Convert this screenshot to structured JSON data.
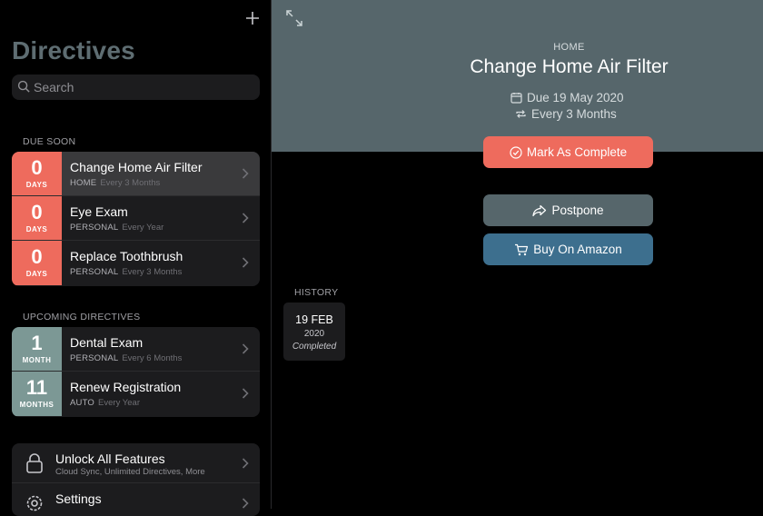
{
  "sidebar": {
    "title": "Directives",
    "search_placeholder": "Search",
    "due_soon_label": "DUE SOON",
    "due_soon": [
      {
        "count": "0",
        "unit": "DAYS",
        "name": "Change Home Air Filter",
        "category": "HOME",
        "frequency": "Every 3 Months"
      },
      {
        "count": "0",
        "unit": "DAYS",
        "name": "Eye Exam",
        "category": "PERSONAL",
        "frequency": "Every Year"
      },
      {
        "count": "0",
        "unit": "DAYS",
        "name": "Replace Toothbrush",
        "category": "PERSONAL",
        "frequency": "Every 3 Months"
      }
    ],
    "upcoming_label": "UPCOMING DIRECTIVES",
    "upcoming": [
      {
        "count": "1",
        "unit": "MONTH",
        "name": "Dental Exam",
        "category": "PERSONAL",
        "frequency": "Every 6 Months"
      },
      {
        "count": "11",
        "unit": "MONTHS",
        "name": "Renew Registration",
        "category": "AUTO",
        "frequency": "Every Year"
      }
    ],
    "unlock": {
      "title": "Unlock All Features",
      "subtitle": "Cloud Sync, Unlimited Directives, More"
    },
    "settings": {
      "title": "Settings"
    }
  },
  "detail": {
    "category": "HOME",
    "title": "Change Home Air Filter",
    "due": "Due 19 May 2020",
    "frequency": "Every 3 Months",
    "complete_label": "Mark As Complete",
    "postpone_label": "Postpone",
    "amazon_label": "Buy On Amazon",
    "history_label": "HISTORY",
    "history": [
      {
        "date": "19 FEB",
        "year": "2020",
        "status": "Completed"
      }
    ]
  },
  "icons": {
    "add": "plus-icon",
    "search": "search-icon",
    "chevron": "chevron-right-icon",
    "lock": "lock-icon",
    "settings": "gear-icon",
    "expand": "expand-icon",
    "calendar": "calendar-icon",
    "repeat": "repeat-icon",
    "check": "check-circle-icon",
    "postpone": "share-arrow-icon",
    "cart": "cart-icon"
  },
  "colors": {
    "accent_red": "#ee6b5d",
    "accent_teal": "#7c9895",
    "hero_bg": "#56666b",
    "amazon_blue": "#3d6f8e",
    "title_gray": "#5e6d72"
  }
}
